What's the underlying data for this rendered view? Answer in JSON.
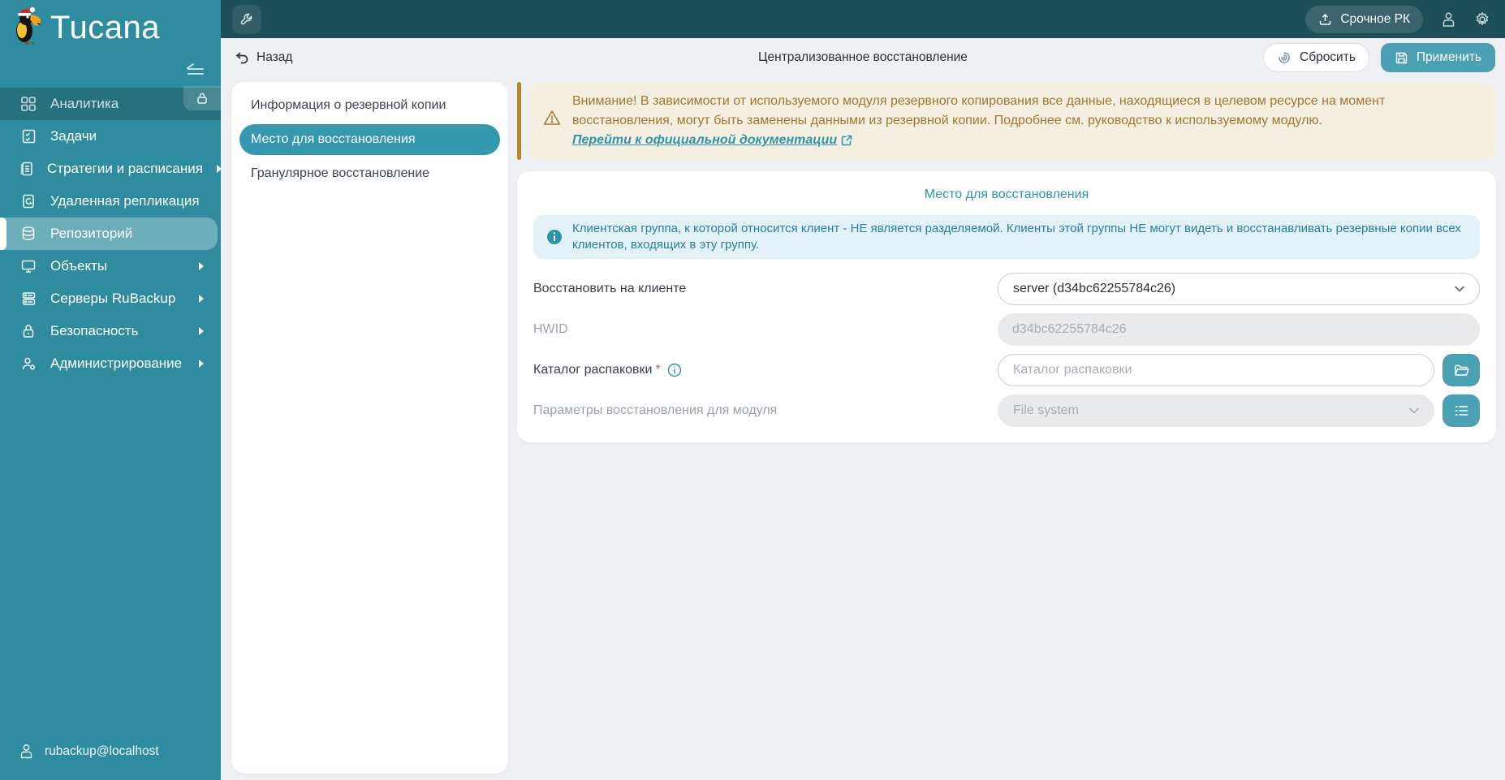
{
  "app": {
    "title": "Tucana"
  },
  "topbar": {
    "urgent_backup_label": "Срочное РК"
  },
  "header": {
    "back_label": "Назад",
    "title": "Централизованное восстановление",
    "reset_label": "Сбросить",
    "apply_label": "Применить"
  },
  "sidebar": {
    "items": [
      {
        "label": "Аналитика",
        "icon": "grid-icon",
        "locked": true
      },
      {
        "label": "Задачи",
        "icon": "tasks-icon"
      },
      {
        "label": "Стратегии и расписания",
        "icon": "strategies-icon",
        "expandable": true
      },
      {
        "label": "Удаленная репликация",
        "icon": "replication-icon"
      },
      {
        "label": "Репозиторий",
        "icon": "repository-icon",
        "active": true
      },
      {
        "label": "Объекты",
        "icon": "objects-icon",
        "expandable": true
      },
      {
        "label": "Серверы RuBackup",
        "icon": "servers-icon",
        "expandable": true
      },
      {
        "label": "Безопасность",
        "icon": "security-icon",
        "expandable": true
      },
      {
        "label": "Администрирование",
        "icon": "administration-icon",
        "expandable": true
      }
    ],
    "user": "rubackup@localhost"
  },
  "tabs": [
    {
      "label": "Информация о резервной копии"
    },
    {
      "label": "Место для восстановления",
      "active": true
    },
    {
      "label": "Гранулярное восстановление"
    }
  ],
  "warning": {
    "text": "Внимание! В зависимости от используемого модуля резервного копирования все данные, находящиеся в целевом ресурсе на момент восстановления, могут быть заменены данными из резервной копии. Подробнее см. руководство к используемому модулю.",
    "link_label": "Перейти к официальной документации"
  },
  "form": {
    "title": "Место для восстановления",
    "info": "Клиентская группа, к которой относится клиент - НЕ является разделяемой. Клиенты этой группы НЕ могут видеть и восстанавливать резервные копии всех клиентов, входящих в эту группу.",
    "fields": {
      "client": {
        "label": "Восстановить на клиенте",
        "value": "server (d34bc62255784c26)"
      },
      "hwid": {
        "label": "HWID",
        "value": "d34bc62255784c26"
      },
      "unpack_dir": {
        "label": "Каталог распаковки",
        "required_mark": "*",
        "placeholder": "Каталог распаковки"
      },
      "module_params": {
        "label": "Параметры восстановления для модуля",
        "value": "File system"
      }
    }
  },
  "colors": {
    "sidebar": "#2F8C9E",
    "topbar": "#1E4E59",
    "accent": "#4BA1B3",
    "tab_active": "#3598AE",
    "warning_bg": "#F5EFE2",
    "warning_border": "#B8892B",
    "warning_text": "#A4762F",
    "info_bg": "#E3F2F8",
    "info_text": "#2A8096",
    "link": "#2E94A8",
    "page_bg": "#EEF0F4"
  }
}
